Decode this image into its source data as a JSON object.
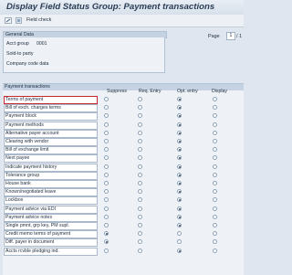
{
  "window": {
    "title": "Display Field Status Group: Payment transactions"
  },
  "toolbar": {
    "field_check_label": "Field check"
  },
  "general_data": {
    "heading": "General Data",
    "acct_group_label": "Acct group",
    "acct_group_value": "0001",
    "sold_to": "Sold-to party",
    "company_code": "Company code data"
  },
  "pager": {
    "page_label": "Page",
    "page_value": "1",
    "of_text": "/ 1"
  },
  "payment": {
    "heading": "Payment transactions",
    "columns": [
      "Suppress",
      "Req. Entry",
      "Opt. entry",
      "Display"
    ],
    "rows": [
      {
        "label": "Terms of payment",
        "selected": 2
      },
      {
        "label": "Bill of exch. charges terms",
        "selected": 2
      },
      {
        "label": "Payment block",
        "selected": 2
      },
      {
        "label": "Payment methods",
        "selected": 2
      },
      {
        "label": "Alternative payer account",
        "selected": 2
      },
      {
        "label": "Clearing with vendor",
        "selected": 2
      },
      {
        "label": "Bill of exchange limit",
        "selected": 2
      },
      {
        "label": "Next payee",
        "selected": 2
      },
      {
        "label": "Indicate payment history",
        "selected": 2
      },
      {
        "label": "Tolerance group",
        "selected": 2
      },
      {
        "label": "House bank",
        "selected": 2
      },
      {
        "label": "Known/negotiated leave",
        "selected": 2
      },
      {
        "label": "Lockbox",
        "selected": 2
      },
      {
        "label": "Payment advice via EDI",
        "selected": 2
      },
      {
        "label": "Payment advice notes",
        "selected": 2
      },
      {
        "label": "Single pmnt, grp key, PM supl.",
        "selected": 2
      },
      {
        "label": "Credit memo terms of payment",
        "selected": 0
      },
      {
        "label": "Diff. payer in document",
        "selected": 0
      },
      {
        "label": "Accts rcvble pledging ind.",
        "selected": 2
      }
    ]
  }
}
